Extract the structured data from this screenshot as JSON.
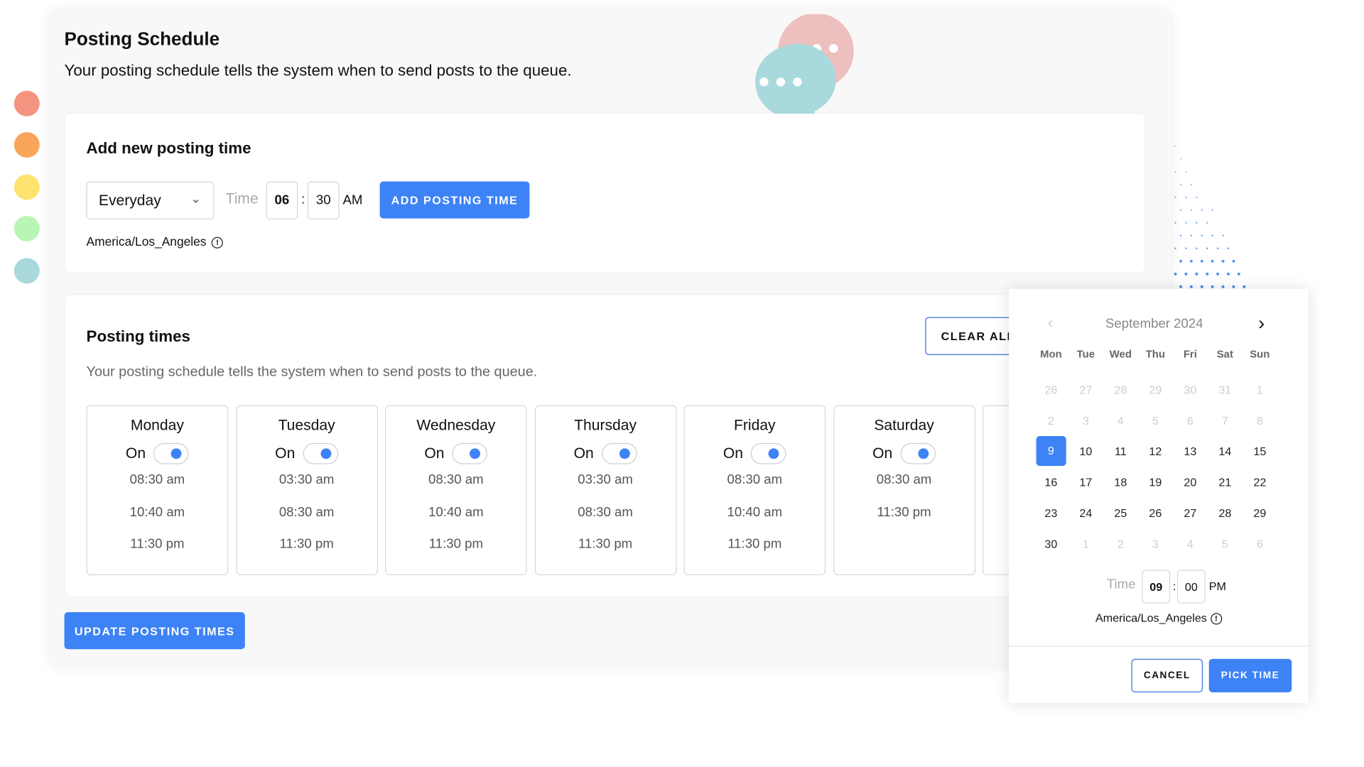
{
  "colors": {
    "accent": "#3d83f6",
    "dots": [
      "#f4937f",
      "#f9a55c",
      "#fde26f",
      "#b9f5b4",
      "#a9d8dd"
    ]
  },
  "header": {
    "title": "Posting Schedule",
    "subtitle": "Your posting schedule tells the system when to send posts to the queue."
  },
  "add_time": {
    "title": "Add new posting time",
    "frequency": "Everyday",
    "time_label": "Time",
    "hour": "06",
    "minute": "30",
    "separator": ":",
    "meridiem": "AM",
    "add_button": "ADD POSTING TIME",
    "timezone": "America/Los_Angeles",
    "info_icon": "!"
  },
  "posting_times": {
    "title": "Posting times",
    "description": "Your posting schedule tells the system when to send posts to the queue.",
    "clear_button": "CLEAR ALL",
    "update_button": "UPDATE POSTING TIMES",
    "days": [
      {
        "name": "Monday",
        "status": "On",
        "enabled": true,
        "times": [
          "08:30 am",
          "10:40 am",
          "11:30 pm"
        ]
      },
      {
        "name": "Tuesday",
        "status": "On",
        "enabled": true,
        "times": [
          "03:30 am",
          "08:30 am",
          "11:30 pm"
        ]
      },
      {
        "name": "Wednesday",
        "status": "On",
        "enabled": true,
        "times": [
          "08:30 am",
          "10:40 am",
          "11:30 pm"
        ]
      },
      {
        "name": "Thursday",
        "status": "On",
        "enabled": true,
        "times": [
          "03:30 am",
          "08:30 am",
          "11:30 pm"
        ]
      },
      {
        "name": "Friday",
        "status": "On",
        "enabled": true,
        "times": [
          "08:30 am",
          "10:40 am",
          "11:30 pm"
        ]
      },
      {
        "name": "Saturday",
        "status": "On",
        "enabled": true,
        "times": [
          "08:30 am",
          "11:30 pm"
        ]
      }
    ]
  },
  "calendar": {
    "month": "September 2024",
    "weekdays": [
      "Mon",
      "Tue",
      "Wed",
      "Thu",
      "Fri",
      "Sat",
      "Sun"
    ],
    "cells": [
      "26",
      "27",
      "28",
      "29",
      "30",
      "31",
      "1",
      "2",
      "3",
      "4",
      "5",
      "6",
      "7",
      "8",
      "9",
      "10",
      "11",
      "12",
      "13",
      "14",
      "15",
      "16",
      "17",
      "18",
      "19",
      "20",
      "21",
      "22",
      "23",
      "24",
      "25",
      "26",
      "27",
      "28",
      "29",
      "30",
      "1",
      "2",
      "3",
      "4",
      "5",
      "6"
    ],
    "muted": [
      0,
      1,
      2,
      3,
      4,
      5,
      6,
      7,
      8,
      9,
      10,
      11,
      12,
      13,
      36,
      37,
      38,
      39,
      40,
      41
    ],
    "selected": 14,
    "time_label": "Time",
    "hour": "09",
    "minute": "00",
    "separator": ":",
    "meridiem": "PM",
    "timezone": "America/Los_Angeles",
    "info_icon": "!",
    "cancel": "CANCEL",
    "pick": "PICK TIME"
  }
}
